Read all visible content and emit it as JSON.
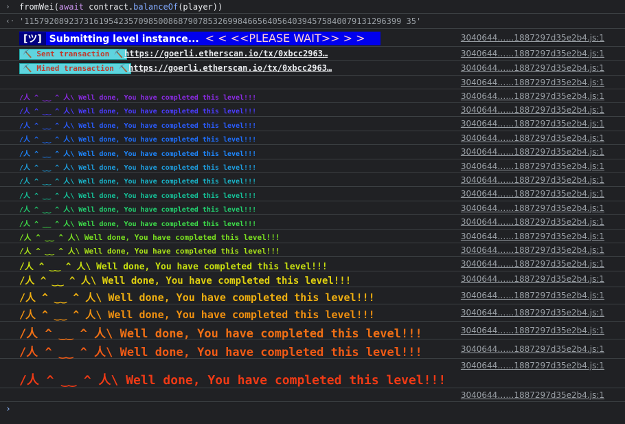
{
  "console": {
    "command_prompt": "›",
    "command_text": {
      "fn": "fromWei(",
      "await": "await",
      "rest1": " contract.",
      "method": "balanceOf",
      "rest2": "(player))"
    },
    "result_arrow": "‹·",
    "result_value": "'1157920892373161954235709850086879078532699846656405640394575840079131296399 35'",
    "source_link": "3040644……1887297d35e2b4.js:1",
    "banner": {
      "icon": "[ツ]",
      "text": "Submitting level instance...",
      "please_wait": "<   <  <<PLEASE WAIT>>  >   >"
    },
    "sent": {
      "label": "⛏️ Sent transaction ⛏️",
      "url": "https://goerli.etherscan.io/tx/0xbcc2963…"
    },
    "mined": {
      "label": "⛏️ Mined transaction ⛏️",
      "url": "https://goerli.etherscan.io/tx/0xbcc2963…"
    },
    "done_message": "/人 ^ ‿‿ ^ 人\\ Well done, You have completed this level!!!",
    "done_colors": [
      "#8a2be2",
      "#4b3cff",
      "#2a5cff",
      "#1e6fff",
      "#1e88ff",
      "#1e9ee0",
      "#19b4c8",
      "#15c39a",
      "#20d070",
      "#3ee04a",
      "#7ae020",
      "#a8e01a",
      "#c8e010",
      "#e0d010",
      "#f0b010",
      "#f09010",
      "#f07015",
      "#f05a15",
      "#f03a15"
    ],
    "input_prompt": "›"
  }
}
